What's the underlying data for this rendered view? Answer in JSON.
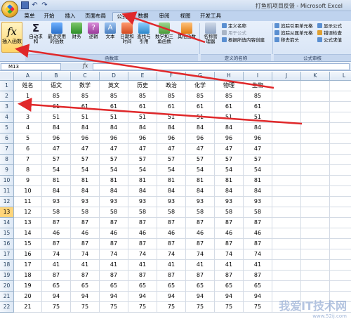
{
  "app": {
    "title": "打鱼机项目反馈 - Microsoft Excel"
  },
  "tabs": [
    {
      "label": "菜单"
    },
    {
      "label": "开始"
    },
    {
      "label": "插入"
    },
    {
      "label": "页面布局"
    },
    {
      "label": "公式"
    },
    {
      "label": "数据"
    },
    {
      "label": "审阅"
    },
    {
      "label": "视图"
    },
    {
      "label": "开发工具"
    }
  ],
  "ribbon": {
    "insert_function": "插入函数",
    "function_library": {
      "buttons": [
        {
          "label": "自动求和",
          "icon": "sigma-icon"
        },
        {
          "label": "最近使用的函数",
          "icon": "recent-icon"
        },
        {
          "label": "财务",
          "icon": "finance-icon"
        },
        {
          "label": "逻辑",
          "icon": "logic-icon"
        },
        {
          "label": "文本",
          "icon": "text-icon"
        },
        {
          "label": "日期和时间",
          "icon": "datetime-icon"
        },
        {
          "label": "查找与引用",
          "icon": "lookup-icon"
        },
        {
          "label": "数学和三角函数",
          "icon": "math-icon"
        },
        {
          "label": "其他函数",
          "icon": "more-functions-icon"
        }
      ],
      "group_label": "函数库"
    },
    "defined_names": {
      "name_manager": "名称管理器",
      "define_name": "定义名称",
      "use_in_formula": "用于公式",
      "create_from_selection": "根据所选内容创建",
      "group_label": "定义的名称"
    },
    "formula_auditing": {
      "trace_precedents": "追踪引用单元格",
      "trace_dependents": "追踪从属单元格",
      "remove_arrows": "移去箭头",
      "show_formulas": "显示公式",
      "error_checking": "错误检查",
      "evaluate_formula": "公式求值",
      "group_label": "公式审核"
    }
  },
  "formula_bar": {
    "name_box": "M13",
    "fx": "fx",
    "formula": ""
  },
  "grid": {
    "columns": [
      "A",
      "B",
      "C",
      "D",
      "E",
      "F",
      "G",
      "H",
      "I",
      "J",
      "K",
      "L"
    ],
    "rows": [
      "1",
      "2",
      "3",
      "4",
      "5",
      "6",
      "7",
      "8",
      "9",
      "10",
      "11",
      "12",
      "13",
      "14",
      "15",
      "16",
      "17",
      "18",
      "19",
      "20",
      "21",
      "22"
    ],
    "data": [
      [
        "姓名",
        "语文",
        "数学",
        "英文",
        "历史",
        "政治",
        "化学",
        "物理",
        "生物"
      ],
      [
        "1",
        "85",
        "85",
        "85",
        "85",
        "85",
        "85",
        "85",
        "85"
      ],
      [
        "2",
        "61",
        "61",
        "61",
        "61",
        "61",
        "61",
        "61",
        "61"
      ],
      [
        "3",
        "51",
        "51",
        "51",
        "51",
        "51",
        "51",
        "51",
        "51"
      ],
      [
        "4",
        "84",
        "84",
        "84",
        "84",
        "84",
        "84",
        "84",
        "84"
      ],
      [
        "5",
        "96",
        "96",
        "96",
        "96",
        "96",
        "96",
        "96",
        "96"
      ],
      [
        "6",
        "47",
        "47",
        "47",
        "47",
        "47",
        "47",
        "47",
        "47"
      ],
      [
        "7",
        "57",
        "57",
        "57",
        "57",
        "57",
        "57",
        "57",
        "57"
      ],
      [
        "8",
        "54",
        "54",
        "54",
        "54",
        "54",
        "54",
        "54",
        "54"
      ],
      [
        "9",
        "81",
        "81",
        "81",
        "81",
        "81",
        "81",
        "81",
        "81"
      ],
      [
        "10",
        "84",
        "84",
        "84",
        "84",
        "84",
        "84",
        "84",
        "84"
      ],
      [
        "11",
        "93",
        "93",
        "93",
        "93",
        "93",
        "93",
        "93",
        "93"
      ],
      [
        "12",
        "58",
        "58",
        "58",
        "58",
        "58",
        "58",
        "58",
        "58"
      ],
      [
        "13",
        "87",
        "87",
        "87",
        "87",
        "87",
        "87",
        "87",
        "87"
      ],
      [
        "14",
        "46",
        "46",
        "46",
        "46",
        "46",
        "46",
        "46",
        "46"
      ],
      [
        "15",
        "87",
        "87",
        "87",
        "87",
        "87",
        "87",
        "87",
        "87"
      ],
      [
        "16",
        "74",
        "74",
        "74",
        "74",
        "74",
        "74",
        "74",
        "74"
      ],
      [
        "17",
        "41",
        "41",
        "41",
        "41",
        "41",
        "41",
        "41",
        "41"
      ],
      [
        "18",
        "87",
        "87",
        "87",
        "87",
        "87",
        "87",
        "87",
        "87"
      ],
      [
        "19",
        "65",
        "65",
        "65",
        "65",
        "65",
        "65",
        "65",
        "65"
      ],
      [
        "20",
        "94",
        "94",
        "94",
        "94",
        "94",
        "94",
        "94",
        "94"
      ],
      [
        "21",
        "75",
        "75",
        "75",
        "75",
        "75",
        "75",
        "75",
        "75"
      ]
    ]
  },
  "watermark": {
    "text": "我爱IT技术网",
    "url": "www.52ij.com"
  },
  "colors": {
    "accent": "#ffd466",
    "arrow": "#e0282a",
    "grid_line": "#d4dbe5"
  }
}
